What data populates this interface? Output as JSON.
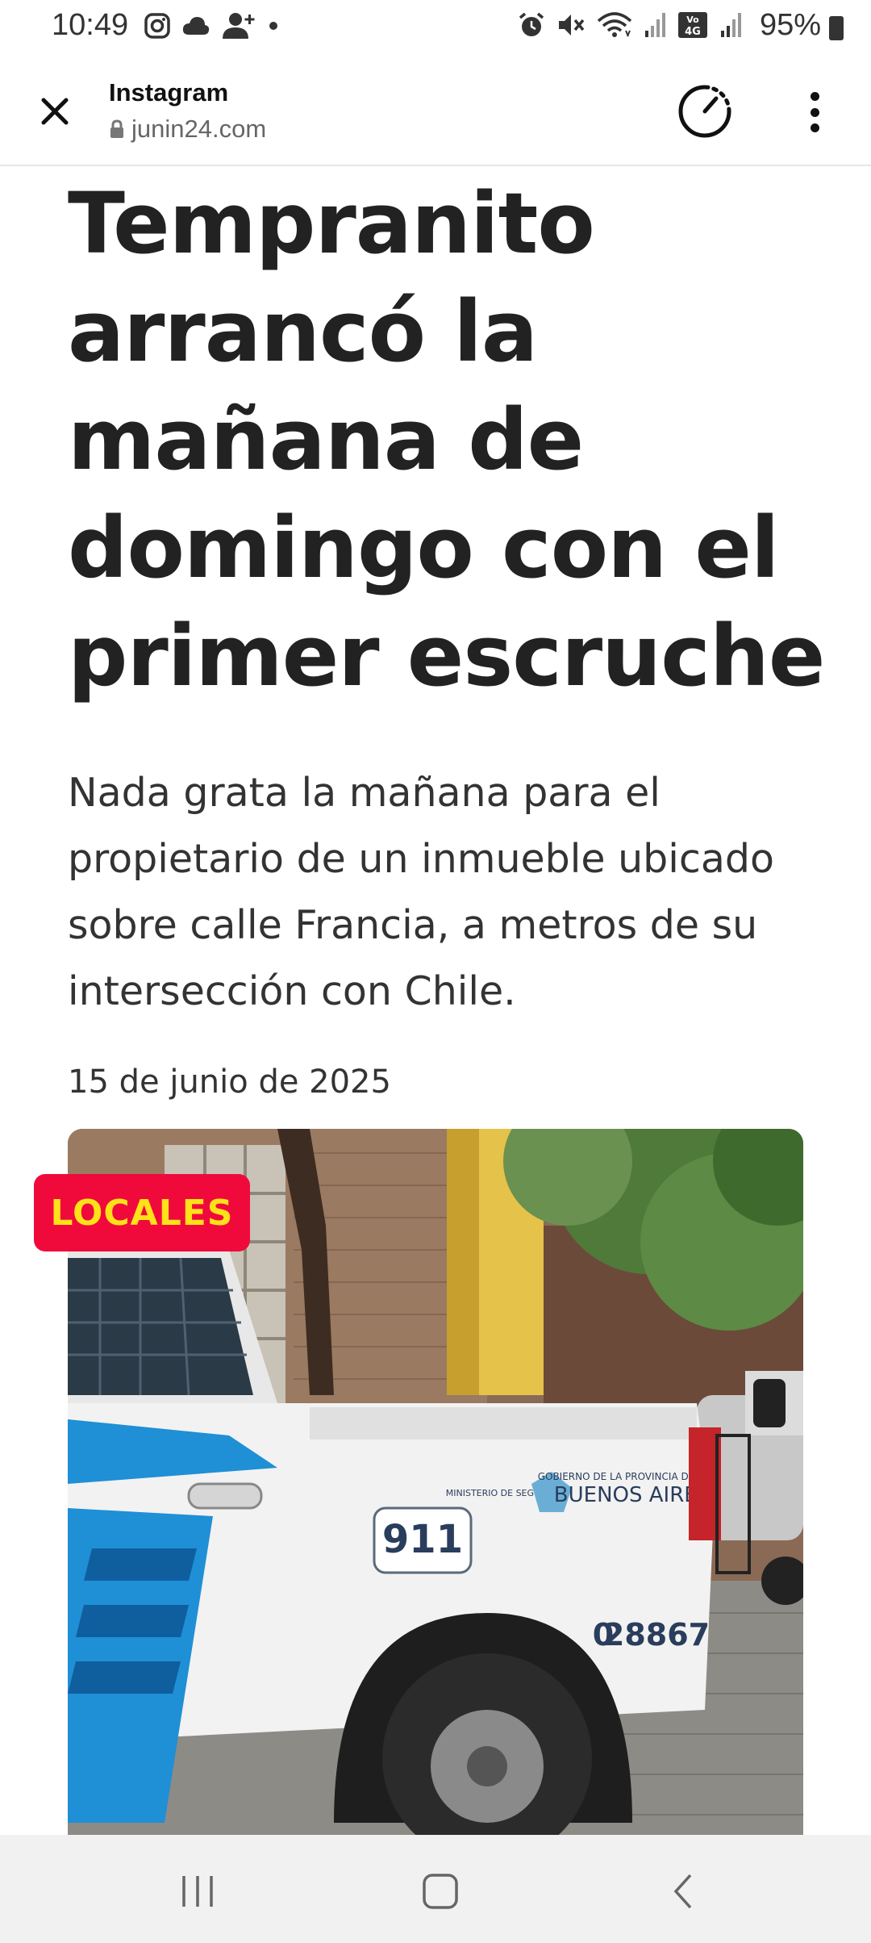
{
  "status_bar": {
    "time": "10:49",
    "battery_percent": "95%",
    "left_icons": [
      "instagram-icon",
      "cloud-icon",
      "person-add-icon",
      "dot-icon"
    ],
    "right_icons": [
      "alarm-icon",
      "mute-icon",
      "wifi-icon",
      "signal-icon",
      "volte-4g-icon",
      "signal-icon",
      "battery-icon"
    ]
  },
  "browser": {
    "title": "Instagram",
    "url": "junin24.com",
    "icons": [
      "close-icon",
      "lock-icon",
      "speed-icon",
      "more-vert-icon"
    ]
  },
  "article": {
    "headline": "Tempranito arrancó la mañana de domingo con el primer escruche",
    "subtitle": "Nada grata la mañana para el propietario de un inmueble ubicado sobre calle Francia, a metros de su intersección con Chile.",
    "date": "15 de junio de 2025",
    "category": "LOCALES",
    "category_colors": {
      "background": "#f00a3c",
      "text": "#ffe11a"
    },
    "image": {
      "subject": "police pickup truck",
      "truck_texts": {
        "phone": "911",
        "agency": "BUENOS AIRES",
        "agency_small": "GOBIERNO DE LA PROVINCIA DE",
        "ministry": "MINISTERIO DE SEGURIDAD",
        "unit_number": "28867",
        "unit_prefix": "0"
      }
    }
  },
  "nav_bar": {
    "buttons": [
      "recent-apps-icon",
      "home-icon",
      "back-icon"
    ]
  }
}
